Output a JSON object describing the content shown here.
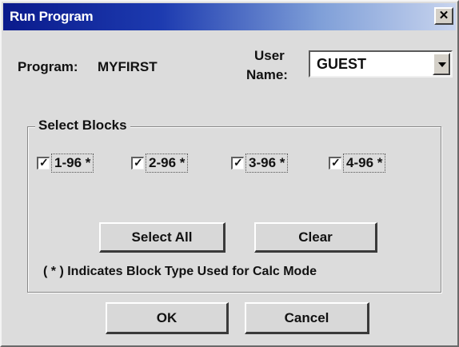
{
  "window": {
    "title": "Run Program",
    "close_glyph": "✕"
  },
  "program": {
    "label": "Program:",
    "value": "MYFIRST"
  },
  "user": {
    "label_line1": "User",
    "label_line2": "Name:",
    "selected": "GUEST"
  },
  "blocks": {
    "group_label": "Select Blocks",
    "items": [
      {
        "label": "1-96 *",
        "checked": true
      },
      {
        "label": "2-96 *",
        "checked": true
      },
      {
        "label": "3-96 *",
        "checked": true
      },
      {
        "label": "4-96 *",
        "checked": true
      }
    ],
    "check_glyph": "✓"
  },
  "buttons": {
    "select_all": "Select All",
    "clear": "Clear",
    "ok": "OK",
    "cancel": "Cancel"
  },
  "note": "( * )  Indicates Block Type Used for Calc Mode",
  "colors": {
    "titlebar_start": "#0a1a8c",
    "titlebar_end": "#c8d4ee",
    "dialog_face": "#dcdcdc"
  },
  "icons": {
    "close": "close-icon",
    "dropdown": "chevron-down-icon",
    "check": "check-icon"
  }
}
